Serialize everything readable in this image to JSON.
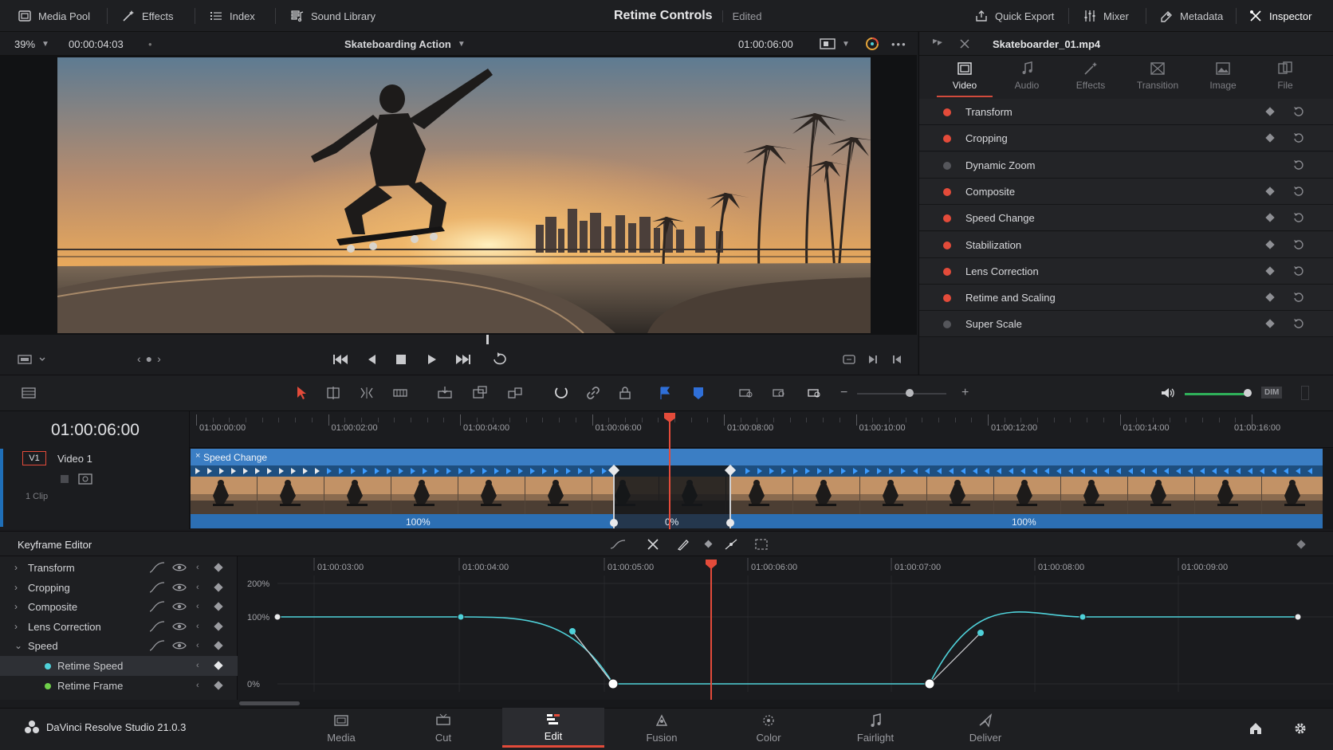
{
  "topbar": {
    "left": [
      {
        "label": "Media Pool",
        "icon": "media-pool-icon"
      },
      {
        "label": "Effects",
        "icon": "effects-wand-icon"
      },
      {
        "label": "Index",
        "icon": "index-list-icon"
      },
      {
        "label": "Sound Library",
        "icon": "sound-library-icon"
      }
    ],
    "title": "Retime Controls",
    "status": "Edited",
    "right": [
      {
        "label": "Quick Export",
        "icon": "export-icon"
      },
      {
        "label": "Mixer",
        "icon": "mixer-icon"
      },
      {
        "label": "Metadata",
        "icon": "metadata-icon"
      },
      {
        "label": "Inspector",
        "icon": "inspector-icon"
      }
    ]
  },
  "viewer": {
    "zoom": "39%",
    "source_timecode": "00:00:04:03",
    "clip_title": "Skateboarding Action",
    "timecode": "01:00:06:00"
  },
  "inspector": {
    "clip_name": "Skateboarder_01.mp4",
    "tabs": [
      {
        "label": "Video",
        "active": true
      },
      {
        "label": "Audio",
        "active": false
      },
      {
        "label": "Effects",
        "active": false
      },
      {
        "label": "Transition",
        "active": false
      },
      {
        "label": "Image",
        "active": false
      },
      {
        "label": "File",
        "active": false
      }
    ],
    "rows": [
      {
        "label": "Transform",
        "enabled": true,
        "keyframe": true
      },
      {
        "label": "Cropping",
        "enabled": true,
        "keyframe": true
      },
      {
        "label": "Dynamic Zoom",
        "enabled": false,
        "keyframe": false
      },
      {
        "label": "Composite",
        "enabled": true,
        "keyframe": true
      },
      {
        "label": "Speed Change",
        "enabled": true,
        "keyframe": true
      },
      {
        "label": "Stabilization",
        "enabled": true,
        "keyframe": true
      },
      {
        "label": "Lens Correction",
        "enabled": true,
        "keyframe": true
      },
      {
        "label": "Retime and Scaling",
        "enabled": true,
        "keyframe": true
      },
      {
        "label": "Super Scale",
        "enabled": false,
        "keyframe": true
      }
    ]
  },
  "timeline": {
    "timecode": "01:00:06:00",
    "ruler": [
      "01:00:00:00",
      "01:00:02:00",
      "01:00:04:00",
      "01:00:06:00",
      "01:00:08:00",
      "01:00:10:00",
      "01:00:12:00",
      "01:00:14:00",
      "01:00:16:00"
    ],
    "track_id": "V1",
    "track_name": "Video 1",
    "clip_count": "1 Clip",
    "clip_header": "Speed Change",
    "segments": [
      "100%",
      "0%",
      "100%"
    ]
  },
  "keyframe_editor": {
    "title": "Keyframe Editor",
    "rows": [
      {
        "label": "Transform",
        "type": "group"
      },
      {
        "label": "Cropping",
        "type": "group"
      },
      {
        "label": "Composite",
        "type": "group"
      },
      {
        "label": "Lens Correction",
        "type": "group"
      },
      {
        "label": "Speed",
        "type": "group-open"
      },
      {
        "label": "Retime Speed",
        "type": "child-selected"
      },
      {
        "label": "Retime Frame",
        "type": "child"
      }
    ],
    "ruler": [
      "01:00:03:00",
      "01:00:04:00",
      "01:00:05:00",
      "01:00:06:00",
      "01:00:07:00",
      "01:00:08:00",
      "01:00:09:00"
    ],
    "y_labels": [
      "200%",
      "100%",
      "0%"
    ]
  },
  "pages": [
    {
      "label": "Media",
      "active": false
    },
    {
      "label": "Cut",
      "active": false
    },
    {
      "label": "Edit",
      "active": true
    },
    {
      "label": "Fusion",
      "active": false
    },
    {
      "label": "Color",
      "active": false
    },
    {
      "label": "Fairlight",
      "active": false
    },
    {
      "label": "Deliver",
      "active": false
    }
  ],
  "app": {
    "name": "DaVinci Resolve Studio 21.0.3"
  },
  "audio": {
    "dim_label": "DIM"
  },
  "colors": {
    "accent_red": "#e34b3a",
    "curve_teal": "#4fd1d9",
    "clip_blue": "#2c6fb3"
  }
}
